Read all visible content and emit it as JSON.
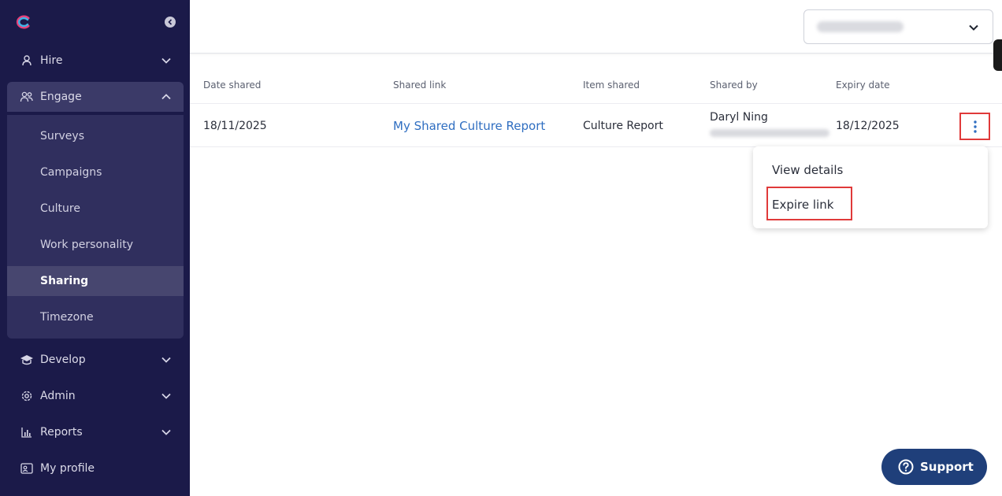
{
  "sidebar": {
    "items": [
      {
        "label": "Hire"
      },
      {
        "label": "Engage"
      },
      {
        "label": "Develop"
      },
      {
        "label": "Admin"
      },
      {
        "label": "Reports"
      },
      {
        "label": "My profile"
      }
    ],
    "engage_sub": [
      {
        "label": "Surveys"
      },
      {
        "label": "Campaigns"
      },
      {
        "label": "Culture"
      },
      {
        "label": "Work personality"
      },
      {
        "label": "Sharing",
        "active": true
      },
      {
        "label": "Timezone"
      }
    ]
  },
  "table": {
    "headers": [
      "Date shared",
      "Shared link",
      "Item shared",
      "Shared by",
      "Expiry date"
    ],
    "rows": [
      {
        "date_shared": "18/11/2025",
        "shared_link": "My Shared Culture Report",
        "item_shared": "Culture Report",
        "shared_by": "Daryl Ning",
        "expiry_date": "18/12/2025"
      }
    ]
  },
  "menu": {
    "view_details": "View details",
    "expire_link": "Expire link"
  },
  "support": {
    "label": "Support"
  },
  "colors": {
    "sidebar_bg": "#1b1a49",
    "accent_link": "#2f6ec1",
    "highlight_red": "#e03a3a",
    "support_bg": "#1f3f7a"
  }
}
